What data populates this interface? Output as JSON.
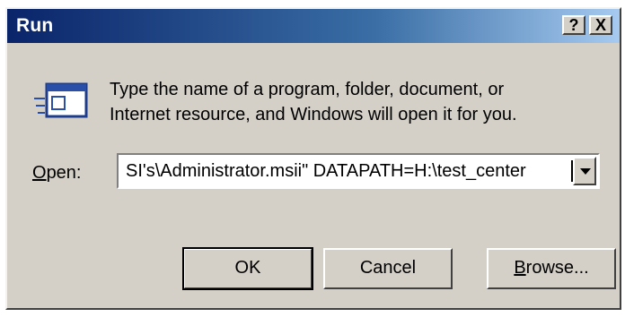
{
  "window": {
    "title": "Run",
    "help_label": "?",
    "close_label": "X"
  },
  "description": {
    "line1": "Type the name of a program, folder, document, or",
    "line2": "Internet resource, and Windows will open it for you."
  },
  "open": {
    "label_accel": "O",
    "label_rest": "pen:",
    "value": "SI's\\Administrator.msii\" DATAPATH=H:\\test_center"
  },
  "buttons": {
    "ok": "OK",
    "cancel": "Cancel",
    "browse_accel": "B",
    "browse_rest": "rowse..."
  },
  "icons": {
    "run": "run-dialog-icon",
    "dropdown": "chevron-down-icon"
  }
}
